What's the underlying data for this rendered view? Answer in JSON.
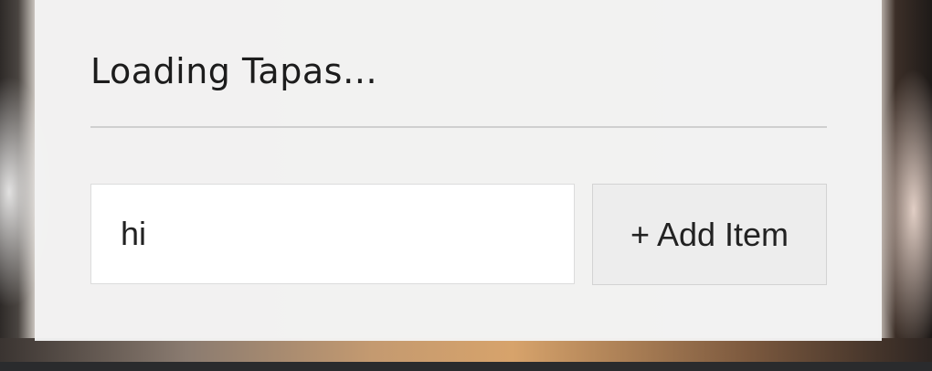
{
  "todo": {
    "title": "Loading Tapas…",
    "input_value": "hi",
    "add_button_label": "+ Add Item"
  }
}
